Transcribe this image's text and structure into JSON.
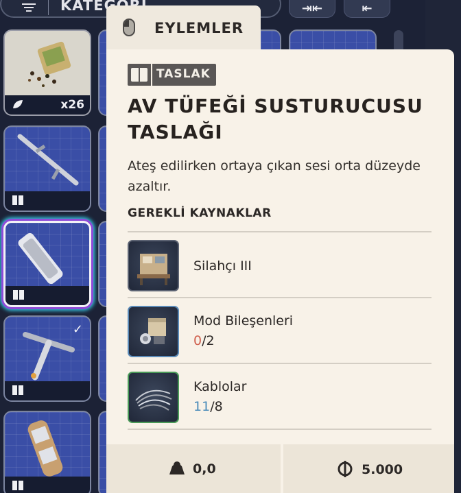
{
  "inventory": {
    "category_label": "KATEGORİ",
    "stack_count": "x26"
  },
  "tooltip": {
    "actions_tab": "EYLEMLER",
    "badge": "TASLAK",
    "title": "AV TÜFEĞİ SUSTURUCUSU TASLAĞI",
    "description": "Ateş edilirken ortaya çıkan sesi orta düzeyde azaltır.",
    "requirements_heading": "GEREKLİ KAYNAKLAR",
    "resources": [
      {
        "name": "Silahçı III",
        "have": "",
        "sep": "",
        "need": ""
      },
      {
        "name": "Mod Bileşenleri",
        "have": "0",
        "sep": "/",
        "need": "2"
      },
      {
        "name": "Kablolar",
        "have": "11",
        "sep": "/",
        "need": "8"
      }
    ],
    "weight": "0,0",
    "value": "5.000"
  },
  "colors": {
    "panel": "#f8f2e8",
    "insufficient": "#d0604e",
    "sufficient": "#4a8cba",
    "slot_blue": "#3a4ea6"
  },
  "icons": [
    "filter-icon",
    "mouse-icon",
    "book-icon",
    "weight-icon",
    "coin-icon",
    "check-icon"
  ]
}
